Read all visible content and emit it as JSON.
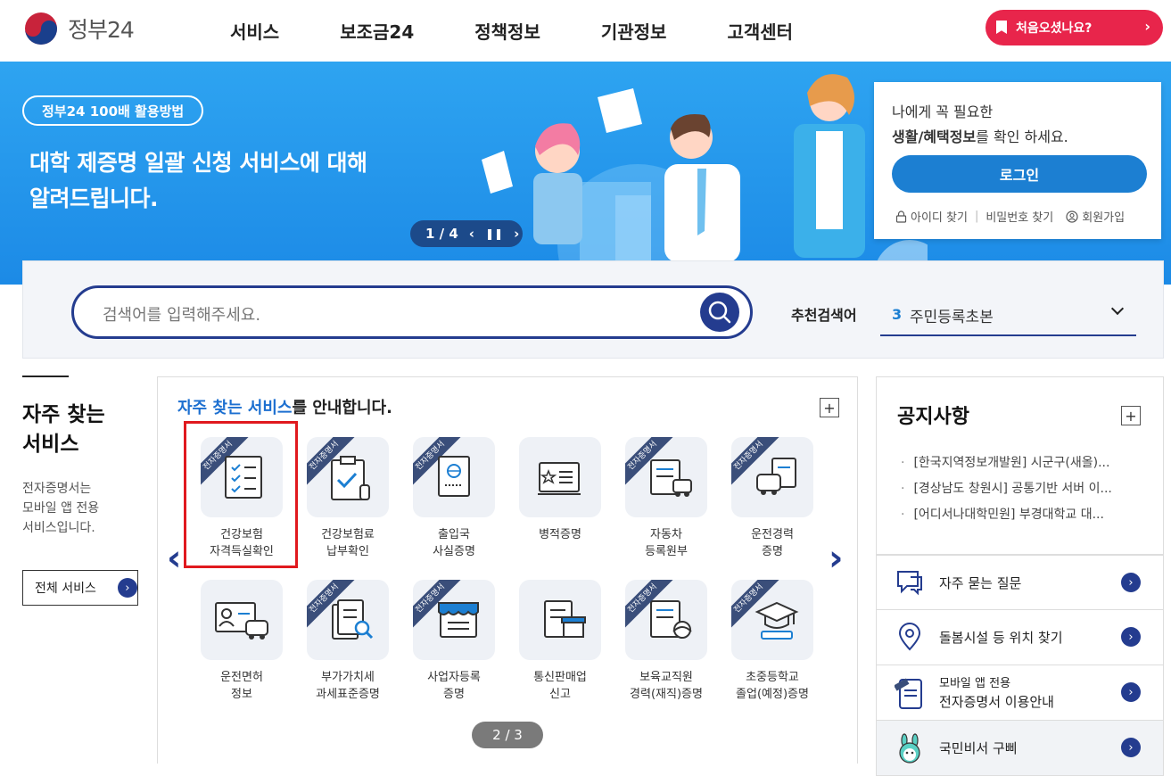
{
  "header": {
    "logo_text": "정부24",
    "nav": [
      "서비스",
      "보조금24",
      "정책정보",
      "기관정보",
      "고객센터"
    ],
    "first_visit": "처음오셨나요?"
  },
  "banner": {
    "tag": "정부24 100배 활용방법",
    "title_line1": "대학 제증명 일괄 신청 서비스에 대해",
    "title_line2": "알려드립니다.",
    "slide_counter": "1 / 4"
  },
  "login": {
    "msg1": "나에게 꼭 필요한",
    "msg2_bold": "생활/혜택정보",
    "msg2_rest": "를 확인 하세요.",
    "button": "로그인",
    "find_id": "아이디 찾기",
    "find_pw": "비밀번호 찾기",
    "signup": "회원가입"
  },
  "search": {
    "placeholder": "검색어를 입력해주세요.",
    "rec_label": "추천검색어",
    "rec_num": "3",
    "rec_text": "주민등록초본"
  },
  "left": {
    "title_line1": "자주 찾는",
    "title_line2": "서비스",
    "desc_line1": "전자증명서는",
    "desc_line2": "모바일 앱 전용",
    "desc_line3": "서비스입니다.",
    "all_button": "전체 서비스"
  },
  "services": {
    "heading_highlight": "자주 찾는 서비스",
    "heading_rest": "를 안내합니다.",
    "ribbon": "전자증명서",
    "items": [
      {
        "line1": "건강보험",
        "line2": "자격득실확인",
        "icon": "checklist-icon"
      },
      {
        "line1": "건강보험료",
        "line2": "납부확인",
        "icon": "clipboard-check-icon"
      },
      {
        "line1": "출입국",
        "line2": "사실증명",
        "icon": "passport-icon"
      },
      {
        "line1": "병적증명",
        "line2": "",
        "icon": "military-card-icon"
      },
      {
        "line1": "자동차",
        "line2": "등록원부",
        "icon": "car-document-icon"
      },
      {
        "line1": "운전경력",
        "line2": "증명",
        "icon": "car-record-icon"
      },
      {
        "line1": "운전면허",
        "line2": "정보",
        "icon": "license-icon"
      },
      {
        "line1": "부가가치세",
        "line2": "과세표준증명",
        "icon": "tax-document-icon"
      },
      {
        "line1": "사업자등록",
        "line2": "증명",
        "icon": "store-icon"
      },
      {
        "line1": "통신판매업",
        "line2": "신고",
        "icon": "online-store-icon"
      },
      {
        "line1": "보육교직원",
        "line2": "경력(재직)증명",
        "icon": "teacher-document-icon"
      },
      {
        "line1": "초중등학교",
        "line2": "졸업(예정)증명",
        "icon": "graduation-icon"
      }
    ],
    "pager": "2 / 3"
  },
  "notice": {
    "title": "공지사항",
    "items": [
      "[한국지역정보개발원] 시군구(새올)...",
      "[경상남도 창원시] 공통기반 서버 이...",
      "[어디서나대학민원] 부경대학교 대..."
    ]
  },
  "quick": {
    "faq": "자주 묻는 질문",
    "care": "돌봄시설 등 위치 찾기",
    "mobile_line1": "모바일 앱 전용",
    "mobile_line2": "전자증명서 이용안내",
    "assistant": "국민비서 구삐"
  },
  "colors": {
    "primary": "#243c8f",
    "accent_red": "#e8254b",
    "banner_blue": "#2ea4f1",
    "highlight": "#1c6fd0"
  }
}
